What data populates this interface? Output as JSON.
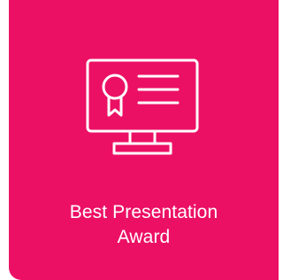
{
  "card": {
    "title_line1": "Best Presentation",
    "title_line2": "Award",
    "icon": "certificate-monitor-icon",
    "accent_color": "#EC1065",
    "text_color": "#FFFFFF"
  }
}
